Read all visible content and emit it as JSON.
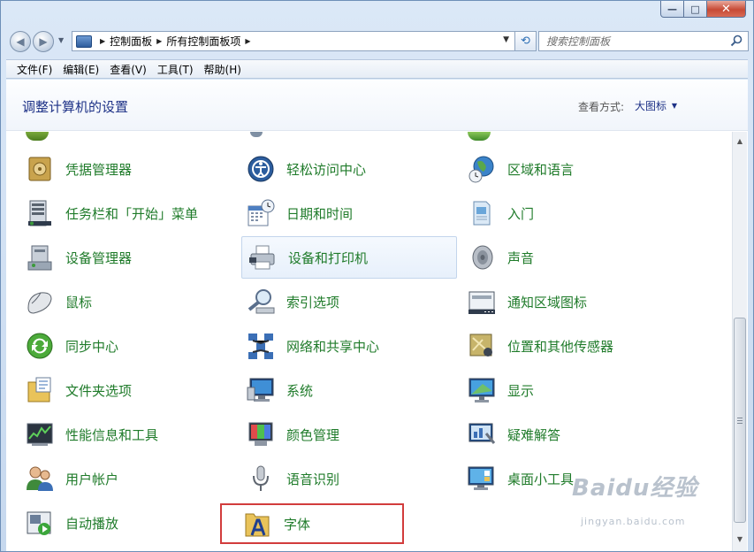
{
  "window": {
    "min_symbol": "—",
    "max_symbol": "□",
    "close_symbol": "✕"
  },
  "breadcrumb": [
    "控制面板",
    "所有控制面板项"
  ],
  "search": {
    "placeholder": "搜索控制面板"
  },
  "menu": [
    "文件(F)",
    "编辑(E)",
    "查看(V)",
    "工具(T)",
    "帮助(H)"
  ],
  "header": {
    "title": "调整计算机的设置",
    "view_label": "查看方式:",
    "view_value": "大图标"
  },
  "items": [
    {
      "label": "凭据管理器",
      "icon": "vault-icon"
    },
    {
      "label": "轻松访问中心",
      "icon": "ease-of-access-icon"
    },
    {
      "label": "区域和语言",
      "icon": "globe-clock-icon"
    },
    {
      "label": "任务栏和「开始」菜单",
      "icon": "taskbar-icon"
    },
    {
      "label": "日期和时间",
      "icon": "calendar-clock-icon"
    },
    {
      "label": "入门",
      "icon": "getting-started-icon"
    },
    {
      "label": "设备管理器",
      "icon": "device-manager-icon"
    },
    {
      "label": "设备和打印机",
      "icon": "printer-icon"
    },
    {
      "label": "声音",
      "icon": "speaker-icon"
    },
    {
      "label": "鼠标",
      "icon": "mouse-icon"
    },
    {
      "label": "索引选项",
      "icon": "magnifier-icon"
    },
    {
      "label": "通知区域图标",
      "icon": "notification-area-icon"
    },
    {
      "label": "同步中心",
      "icon": "sync-icon"
    },
    {
      "label": "网络和共享中心",
      "icon": "network-icon"
    },
    {
      "label": "位置和其他传感器",
      "icon": "location-sensor-icon"
    },
    {
      "label": "文件夹选项",
      "icon": "folder-options-icon"
    },
    {
      "label": "系统",
      "icon": "system-icon"
    },
    {
      "label": "显示",
      "icon": "display-icon"
    },
    {
      "label": "性能信息和工具",
      "icon": "performance-icon"
    },
    {
      "label": "颜色管理",
      "icon": "color-management-icon"
    },
    {
      "label": "疑难解答",
      "icon": "troubleshooting-icon"
    },
    {
      "label": "用户帐户",
      "icon": "user-accounts-icon"
    },
    {
      "label": "语音识别",
      "icon": "microphone-icon"
    },
    {
      "label": "桌面小工具",
      "icon": "gadgets-icon"
    },
    {
      "label": "自动播放",
      "icon": "autoplay-icon"
    },
    {
      "label": "字体",
      "icon": "fonts-icon"
    }
  ],
  "colors": {
    "label": "#1f7b2a",
    "title": "#1e3287",
    "highlight_border": "#d23c3c"
  },
  "watermark": {
    "main": "Baidu经验",
    "sub": "jingyan.baidu.com"
  }
}
